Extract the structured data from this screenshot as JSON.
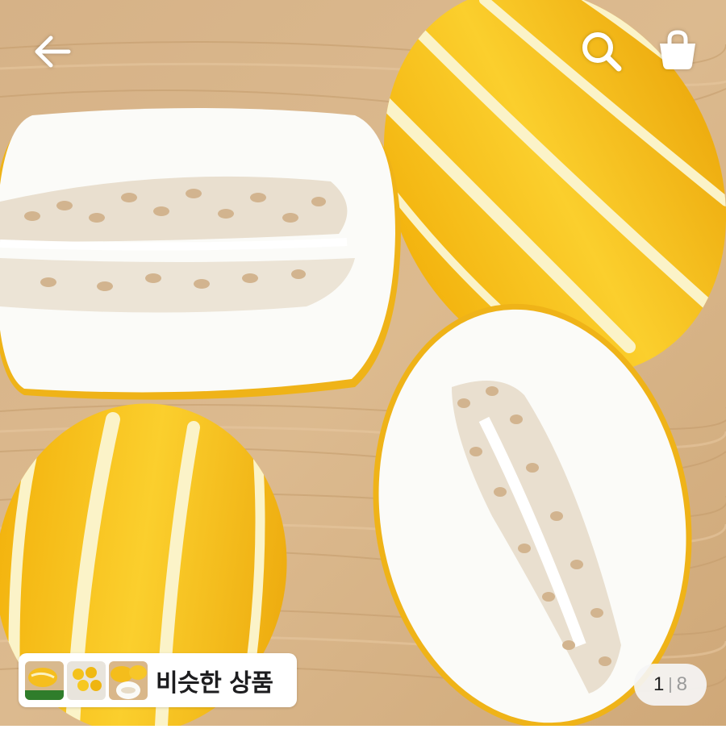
{
  "colors": {
    "wood": "#d9b689",
    "melon_yellow": "#f6c31c",
    "flesh": "#fbfbf8"
  },
  "header": {
    "back_icon": "arrow-left-icon",
    "search_icon": "search-icon",
    "cart_icon": "shopping-bag-icon"
  },
  "similar_products": {
    "label": "비슷한 상품",
    "thumbnails": [
      "melon-thumbnail",
      "yellow-fruit-thumbnail",
      "cut-melon-thumbnail"
    ]
  },
  "pagination": {
    "current": "1",
    "separator": "|",
    "total": "8"
  }
}
